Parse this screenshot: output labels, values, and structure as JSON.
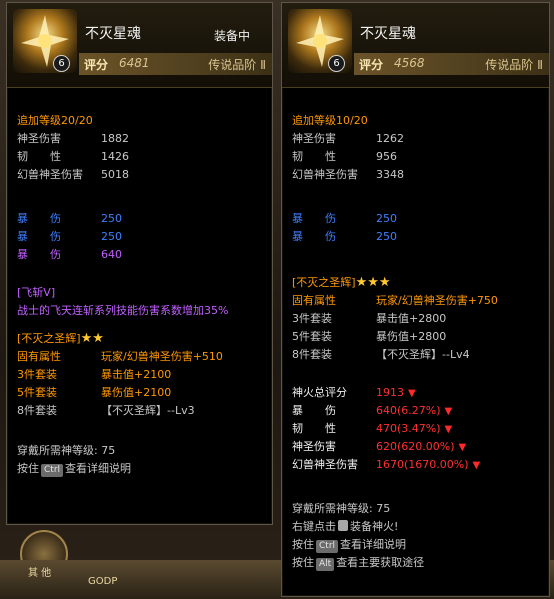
{
  "background": {
    "label_other": "其 他",
    "label_godp": "GODP"
  },
  "tip1": {
    "name": "不灭星魂",
    "equipped": "装备中",
    "level_badge": "6",
    "score_label": "评分",
    "score_value": "6481",
    "rank": "传说品阶 Ⅱ",
    "upgrade_level": "追加等级20/20",
    "base_stats": [
      {
        "label": "神圣伤害",
        "value": "1882"
      },
      {
        "label": "韧　　性",
        "value": "1426"
      },
      {
        "label": "幻兽神圣伤害",
        "value": "5018"
      }
    ],
    "crit_stats": [
      {
        "label": "暴　　伤",
        "value": "250"
      },
      {
        "label": "暴　　伤",
        "value": "250"
      },
      {
        "label": "暴　　伤",
        "value": "640"
      }
    ],
    "skill_title": "[飞斩Ⅴ]",
    "skill_desc": "战士的飞天连斩系列技能伤害系数增加35%",
    "set_title": "[不灭之圣辉]",
    "set_stars": "★★",
    "set_rows": [
      {
        "label": "固有属性",
        "value": "玩家/幻兽神圣伤害+510"
      },
      {
        "label": "3件套装",
        "value": "暴击值+2100"
      },
      {
        "label": "5件套装",
        "value": "暴伤值+2100"
      },
      {
        "label": "8件套装",
        "value": "【不灭圣辉】--Lv3"
      }
    ],
    "req_level": "穿戴所需神等级: 75",
    "hint_prefix": "按住",
    "hint_key": "Ctrl",
    "hint_suffix": "查看详细说明"
  },
  "tip2": {
    "name": "不灭星魂",
    "level_badge": "6",
    "score_label": "评分",
    "score_value": "4568",
    "rank": "传说品阶 Ⅱ",
    "upgrade_level": "追加等级10/20",
    "base_stats": [
      {
        "label": "神圣伤害",
        "value": "1262"
      },
      {
        "label": "韧　　性",
        "value": "956"
      },
      {
        "label": "幻兽神圣伤害",
        "value": "3348"
      }
    ],
    "crit_stats": [
      {
        "label": "暴　　伤",
        "value": "250"
      },
      {
        "label": "暴　　伤",
        "value": "250"
      }
    ],
    "set_title": "[不灭之圣辉]",
    "set_stars": "★★★",
    "set_rows": [
      {
        "label": "固有属性",
        "value": "玩家/幻兽神圣伤害+750"
      },
      {
        "label": "3件套装",
        "value": "暴击值+2800"
      },
      {
        "label": "5件套装",
        "value": "暴伤值+2800"
      },
      {
        "label": "8件套装",
        "value": "【不灭圣辉】--Lv4"
      }
    ],
    "compare": [
      {
        "label": "神火总评分",
        "value": "1913"
      },
      {
        "label": "暴　　伤",
        "value": "640(6.27%)"
      },
      {
        "label": "韧　　性",
        "value": "470(3.47%)"
      },
      {
        "label": "神圣伤害",
        "value": "620(620.00%)"
      },
      {
        "label": "幻兽神圣伤害",
        "value": "1670(1670.00%)"
      }
    ],
    "req_level": "穿戴所需神等级: 75",
    "right_click_prefix": "右键点击",
    "right_click_suffix": "装备神火!",
    "hint1_prefix": "按住",
    "hint1_key": "Ctrl",
    "hint1_suffix": "查看详细说明",
    "hint2_prefix": "按住",
    "hint2_key": "Alt",
    "hint2_suffix": "查看主要获取途径"
  }
}
